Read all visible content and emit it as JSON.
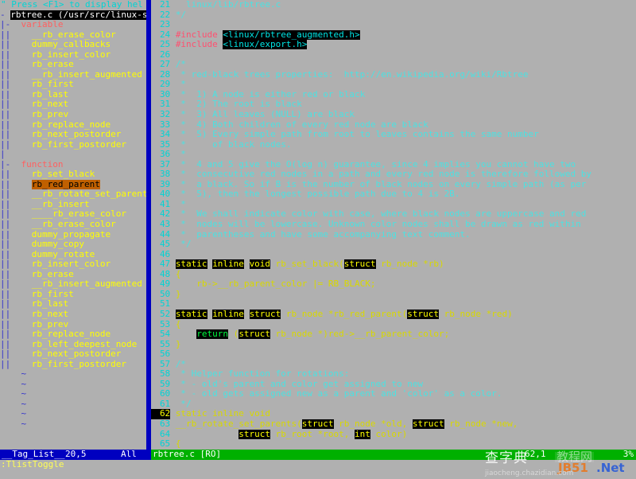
{
  "window": {
    "app": "vim",
    "colors": {
      "background": "#b0b0b0",
      "comment": "#4de1e1",
      "identifier": "#d8d800",
      "keyword_bg": "#000000",
      "keyword_fg": "#ffff00",
      "preproc": "#ff5070",
      "linenumber": "#00d4d4",
      "split_separator": "#0000c0",
      "status_taglist_bg": "#0000c0",
      "status_code_bg": "#00b000",
      "tag_active_bg": "#c06000",
      "cmdline_fg": "#ffff55"
    }
  },
  "taglist": {
    "help_hint": "\" Press <F1> to display hel",
    "file_header": {
      "fold": "-",
      "label": "rbtree.c (/usr/src/linux-so"
    },
    "groups": [
      {
        "fold": "|-",
        "name": "variable",
        "tags": [
          "__rb_erase_color",
          "dummy_callbacks",
          "rb_insert_color",
          "rb_erase",
          "__rb_insert_augmented",
          "rb_first",
          "rb_last",
          "rb_next",
          "rb_prev",
          "rb_replace_node",
          "rb_next_postorder",
          "rb_first_postorder"
        ]
      },
      {
        "fold": "|-",
        "name": "function",
        "tags": [
          "rb_set_black",
          "rb_red_parent",
          "__rb_rotate_set_parents",
          "__rb_insert",
          "____rb_erase_color",
          "__rb_erase_color",
          "dummy_propagate",
          "dummy_copy",
          "dummy_rotate",
          "rb_insert_color",
          "rb_erase",
          "__rb_insert_augmented",
          "rb_first",
          "rb_last",
          "rb_next",
          "rb_prev",
          "rb_replace_node",
          "rb_left_deepest_node",
          "rb_next_postorder",
          "rb_first_postorder"
        ]
      }
    ],
    "active_tag": "rb_red_parent",
    "child_marker": "||",
    "tilde_marker": "~",
    "tilde_count": 6,
    "status": {
      "name": "__Tag_List__",
      "position": "20,5",
      "scroll": "All"
    }
  },
  "code": {
    "status": {
      "filename": "rbtree.c [RO]",
      "position": "62,1",
      "scroll": "3%"
    },
    "lines": [
      {
        "n": "21",
        "tokens": [
          {
            "t": "  linux/lib/rbtree.c",
            "c": "cmt"
          }
        ]
      },
      {
        "n": "22",
        "tokens": [
          {
            "t": "*/",
            "c": "cmt"
          }
        ]
      },
      {
        "n": "23",
        "tokens": [
          {
            "t": "",
            "c": "plain"
          }
        ]
      },
      {
        "n": "24",
        "tokens": [
          {
            "t": "#include ",
            "c": "pre"
          },
          {
            "t": "<linux/rbtree_augmented.h>",
            "c": "inc"
          }
        ]
      },
      {
        "n": "25",
        "tokens": [
          {
            "t": "#include ",
            "c": "pre"
          },
          {
            "t": "<linux/export.h>",
            "c": "inc"
          }
        ]
      },
      {
        "n": "26",
        "tokens": [
          {
            "t": "",
            "c": "plain"
          }
        ]
      },
      {
        "n": "27",
        "tokens": [
          {
            "t": "/*",
            "c": "cmt"
          }
        ]
      },
      {
        "n": "28",
        "tokens": [
          {
            "t": " * red-black trees properties:  http://en.wikipedia.org/wiki/Rbtree",
            "c": "cmt"
          }
        ]
      },
      {
        "n": "29",
        "tokens": [
          {
            "t": " *",
            "c": "cmt"
          }
        ]
      },
      {
        "n": "30",
        "tokens": [
          {
            "t": " *  1) A node is either red or black",
            "c": "cmt"
          }
        ]
      },
      {
        "n": "31",
        "tokens": [
          {
            "t": " *  2) The root is black",
            "c": "cmt"
          }
        ]
      },
      {
        "n": "32",
        "tokens": [
          {
            "t": " *  3) All leaves (NULL) are black",
            "c": "cmt"
          }
        ]
      },
      {
        "n": "33",
        "tokens": [
          {
            "t": " *  4) Both children of every red node are black",
            "c": "cmt"
          }
        ]
      },
      {
        "n": "34",
        "tokens": [
          {
            "t": " *  5) Every simple path from root to leaves contains the same number",
            "c": "cmt"
          }
        ]
      },
      {
        "n": "35",
        "tokens": [
          {
            "t": " *     of black nodes.",
            "c": "cmt"
          }
        ]
      },
      {
        "n": "36",
        "tokens": [
          {
            "t": " *",
            "c": "cmt"
          }
        ]
      },
      {
        "n": "37",
        "tokens": [
          {
            "t": " *  4 and 5 give the O(log n) guarantee, since 4 implies you cannot have two",
            "c": "cmt"
          }
        ]
      },
      {
        "n": "38",
        "tokens": [
          {
            "t": " *  consecutive red nodes in a path and every red node is therefore followed by",
            "c": "cmt"
          }
        ]
      },
      {
        "n": "39",
        "tokens": [
          {
            "t": " *  a black. So if B is the number of black nodes on every simple path (as per",
            "c": "cmt"
          }
        ]
      },
      {
        "n": "40",
        "tokens": [
          {
            "t": " *  5), then the longest possible path due to 4 is 2B.",
            "c": "cmt"
          }
        ]
      },
      {
        "n": "41",
        "tokens": [
          {
            "t": " *",
            "c": "cmt"
          }
        ]
      },
      {
        "n": "42",
        "tokens": [
          {
            "t": " *  We shall indicate color with case, where black nodes are uppercase and red",
            "c": "cmt"
          }
        ]
      },
      {
        "n": "43",
        "tokens": [
          {
            "t": " *  nodes will be lowercase. Unknown color nodes shall be drawn as red within",
            "c": "cmt"
          }
        ]
      },
      {
        "n": "44",
        "tokens": [
          {
            "t": " *  parentheses and have some accompanying text comment.",
            "c": "cmt"
          }
        ]
      },
      {
        "n": "45",
        "tokens": [
          {
            "t": " */",
            "c": "cmt"
          }
        ]
      },
      {
        "n": "46",
        "tokens": [
          {
            "t": "",
            "c": "plain"
          }
        ]
      },
      {
        "n": "47",
        "tokens": [
          {
            "t": "static",
            "c": "kw"
          },
          {
            "t": " ",
            "c": "plain"
          },
          {
            "t": "inline",
            "c": "kw"
          },
          {
            "t": " ",
            "c": "plain"
          },
          {
            "t": "void",
            "c": "kw"
          },
          {
            "t": " rb_set_black(",
            "c": "id"
          },
          {
            "t": "struct",
            "c": "typ"
          },
          {
            "t": " rb_node *rb)",
            "c": "id"
          }
        ]
      },
      {
        "n": "48",
        "tokens": [
          {
            "t": "{",
            "c": "id"
          }
        ]
      },
      {
        "n": "49",
        "tokens": [
          {
            "t": "    rb->__rb_parent_color |= RB_BLACK;",
            "c": "id"
          }
        ]
      },
      {
        "n": "50",
        "tokens": [
          {
            "t": "}",
            "c": "id"
          }
        ]
      },
      {
        "n": "51",
        "tokens": [
          {
            "t": "",
            "c": "plain"
          }
        ]
      },
      {
        "n": "52",
        "tokens": [
          {
            "t": "static",
            "c": "kw"
          },
          {
            "t": " ",
            "c": "plain"
          },
          {
            "t": "inline",
            "c": "kw"
          },
          {
            "t": " ",
            "c": "plain"
          },
          {
            "t": "struct",
            "c": "kw"
          },
          {
            "t": " rb_node *rb_red_parent(",
            "c": "id"
          },
          {
            "t": "struct",
            "c": "typ"
          },
          {
            "t": " rb_node *red)",
            "c": "id"
          }
        ]
      },
      {
        "n": "53",
        "tokens": [
          {
            "t": "{",
            "c": "id"
          }
        ]
      },
      {
        "n": "54",
        "tokens": [
          {
            "t": "    ",
            "c": "plain"
          },
          {
            "t": "return",
            "c": "ret"
          },
          {
            "t": " (",
            "c": "id"
          },
          {
            "t": "struct",
            "c": "typ"
          },
          {
            "t": " rb_node *)red->__rb_parent_color;",
            "c": "id"
          }
        ]
      },
      {
        "n": "55",
        "tokens": [
          {
            "t": "}",
            "c": "id"
          }
        ]
      },
      {
        "n": "56",
        "tokens": [
          {
            "t": "",
            "c": "plain"
          }
        ]
      },
      {
        "n": "57",
        "tokens": [
          {
            "t": "/*",
            "c": "cmt"
          }
        ]
      },
      {
        "n": "58",
        "tokens": [
          {
            "t": " * Helper function for rotations:",
            "c": "cmt"
          }
        ]
      },
      {
        "n": "59",
        "tokens": [
          {
            "t": " * - old's parent and color get assigned to new",
            "c": "cmt"
          }
        ]
      },
      {
        "n": "60",
        "tokens": [
          {
            "t": " * - old gets assigned new as a parent and 'color' as a color.",
            "c": "cmt"
          }
        ]
      },
      {
        "n": "61",
        "tokens": [
          {
            "t": " */",
            "c": "cmt"
          }
        ]
      },
      {
        "n": "62",
        "cursor": true,
        "tokens": [
          {
            "t": "static inline void",
            "c": "id"
          }
        ]
      },
      {
        "n": "63",
        "tokens": [
          {
            "t": "__rb_rotate_set_parents(",
            "c": "id"
          },
          {
            "t": "struct",
            "c": "typ"
          },
          {
            "t": " rb_node *old, ",
            "c": "id"
          },
          {
            "t": "struct",
            "c": "typ"
          },
          {
            "t": " rb_node *new,",
            "c": "id"
          }
        ]
      },
      {
        "n": "64",
        "tokens": [
          {
            "t": "            ",
            "c": "plain"
          },
          {
            "t": "struct",
            "c": "typ"
          },
          {
            "t": " rb_root *root, ",
            "c": "id"
          },
          {
            "t": "int",
            "c": "typ"
          },
          {
            "t": " color)",
            "c": "id"
          }
        ]
      },
      {
        "n": "65",
        "tokens": [
          {
            "t": "{",
            "c": "id"
          }
        ]
      }
    ]
  },
  "cmdline": ":TlistToggle",
  "watermark": {
    "cn_primary": "查字典",
    "cn_secondary": "教程网",
    "url": "jiaocheng.chazidian.com",
    "brand": "JB51",
    "brand_tld": ".Net"
  }
}
